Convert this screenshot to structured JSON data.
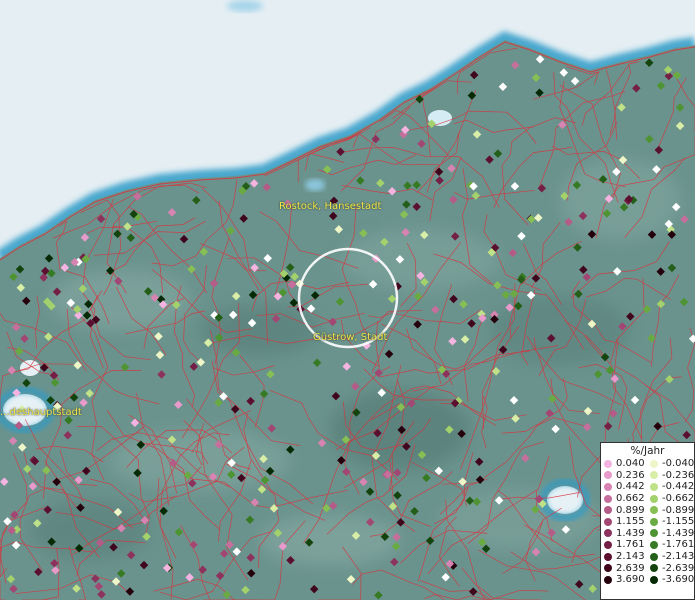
{
  "cities": [
    {
      "id": "rostock",
      "name": "Rostock, Hansestadt"
    },
    {
      "id": "guestrow",
      "name": "Güstrow, Stadt"
    },
    {
      "id": "schwerin",
      "name": "...deshauptstadt"
    }
  ],
  "legend": {
    "title": "%/Jahr",
    "positive": [
      {
        "label": "0.040",
        "color": "#f4b3e0"
      },
      {
        "label": "0.236",
        "color": "#e79acb"
      },
      {
        "label": "0.442",
        "color": "#d784b2"
      },
      {
        "label": "0.662",
        "color": "#c66f9d"
      },
      {
        "label": "0.899",
        "color": "#b55b88"
      },
      {
        "label": "1.155",
        "color": "#a24773"
      },
      {
        "label": "1.439",
        "color": "#8c325d"
      },
      {
        "label": "1.761",
        "color": "#741f45"
      },
      {
        "label": "2.143",
        "color": "#5c1030"
      },
      {
        "label": "2.639",
        "color": "#40061d"
      },
      {
        "label": "3.690",
        "color": "#24000c"
      }
    ],
    "negative": [
      {
        "label": "-0.040",
        "color": "#eef6c8"
      },
      {
        "label": "-0.236",
        "color": "#d8eea6"
      },
      {
        "label": "-0.442",
        "color": "#bfe188"
      },
      {
        "label": "-0.662",
        "color": "#a3d16c"
      },
      {
        "label": "-0.899",
        "color": "#86c055"
      },
      {
        "label": "-1.155",
        "color": "#69ab42"
      },
      {
        "label": "-1.439",
        "color": "#4e9432"
      },
      {
        "label": "-1.761",
        "color": "#377a24"
      },
      {
        "label": "-2.143",
        "color": "#235f18"
      },
      {
        "label": "-2.639",
        "color": "#13440d"
      },
      {
        "label": "-3.690",
        "color": "#062a05"
      }
    ]
  },
  "colors": {
    "sea": "#e4eef3",
    "land": "#6b938d",
    "coast_water": "#2e9bc8",
    "borders": "#d8323c",
    "label": "#f2e84a",
    "highlight_ring": "#ffffff"
  }
}
